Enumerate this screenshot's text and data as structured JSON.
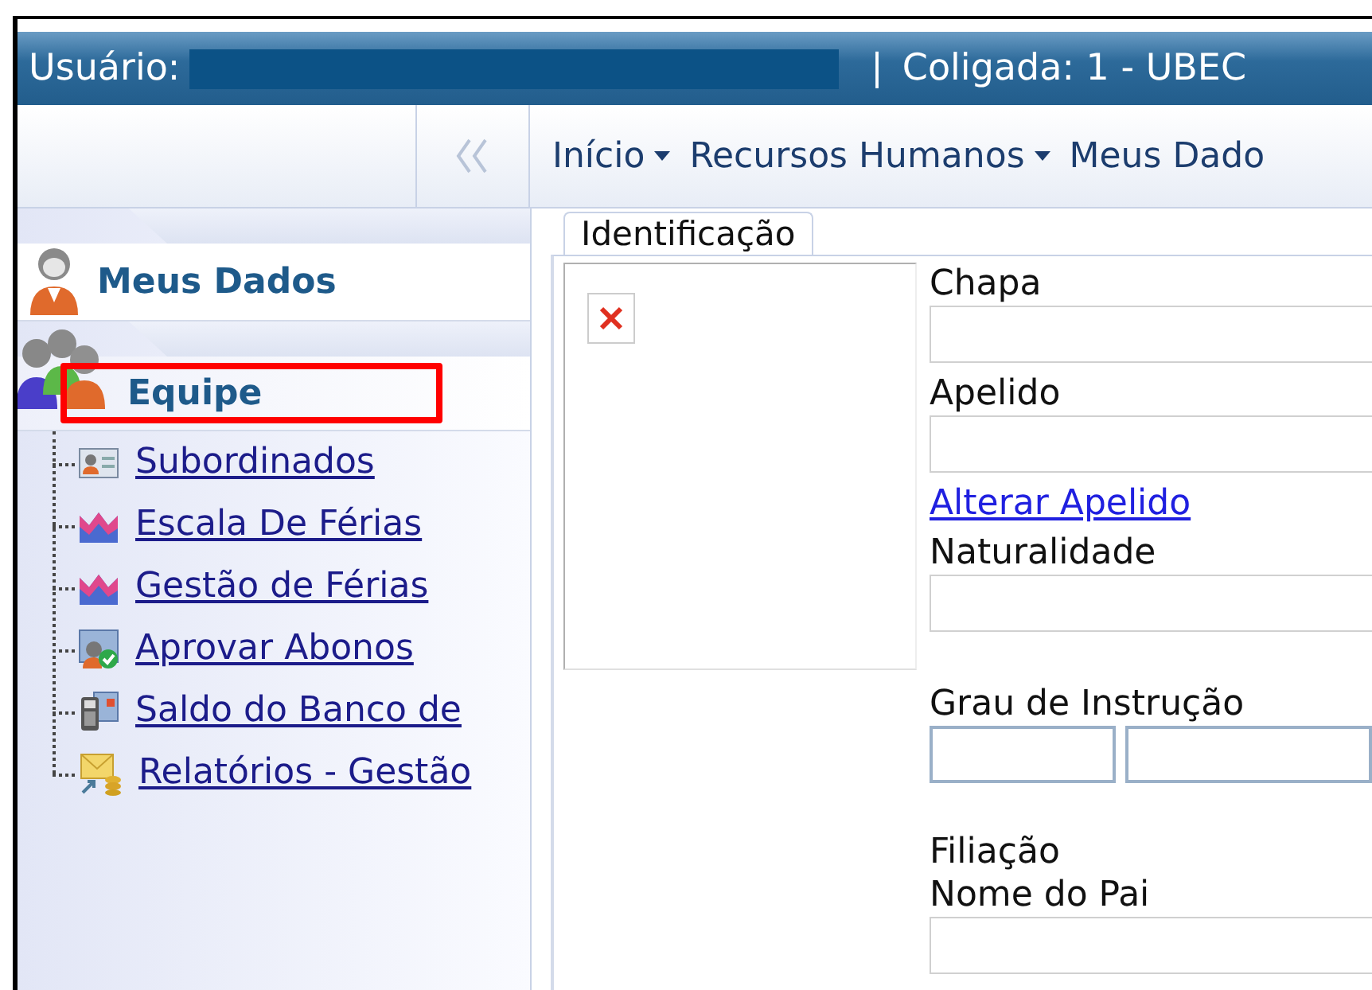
{
  "header": {
    "user_label": "Usuário:",
    "separator": "|",
    "company": "Coligada: 1 - UBEC"
  },
  "toolbar": {
    "menu": [
      {
        "label": "Início",
        "dropdown": true
      },
      {
        "label": "Recursos Humanos",
        "dropdown": true
      },
      {
        "label": "Meus Dado",
        "dropdown": false
      }
    ]
  },
  "sidebar": {
    "sections": [
      {
        "label": "Meus Dados",
        "highlighted": false
      },
      {
        "label": "Equipe",
        "highlighted": true,
        "children": [
          {
            "label": "Subordinados",
            "kind": "card"
          },
          {
            "label": "Escala De Férias",
            "kind": "chart"
          },
          {
            "label": "Gestão de Férias",
            "kind": "chart"
          },
          {
            "label": "Aprovar Abonos",
            "kind": "approve"
          },
          {
            "label": "Saldo do Banco de",
            "kind": "calculator"
          },
          {
            "label": "Relatórios - Gestão",
            "kind": "report"
          }
        ]
      }
    ]
  },
  "form": {
    "tabs": [
      {
        "label": "Identificação",
        "selected": true
      }
    ],
    "fields": [
      {
        "kind": "field",
        "label": "Chapa"
      },
      {
        "kind": "field",
        "label": "Apelido"
      },
      {
        "kind": "link",
        "label": "Alterar Apelido"
      },
      {
        "kind": "field",
        "label": "Naturalidade"
      },
      {
        "kind": "split",
        "label": "Grau de Instrução"
      },
      {
        "kind": "heading",
        "label": "Filiação"
      },
      {
        "kind": "field",
        "label": "Nome do Pai"
      }
    ]
  }
}
